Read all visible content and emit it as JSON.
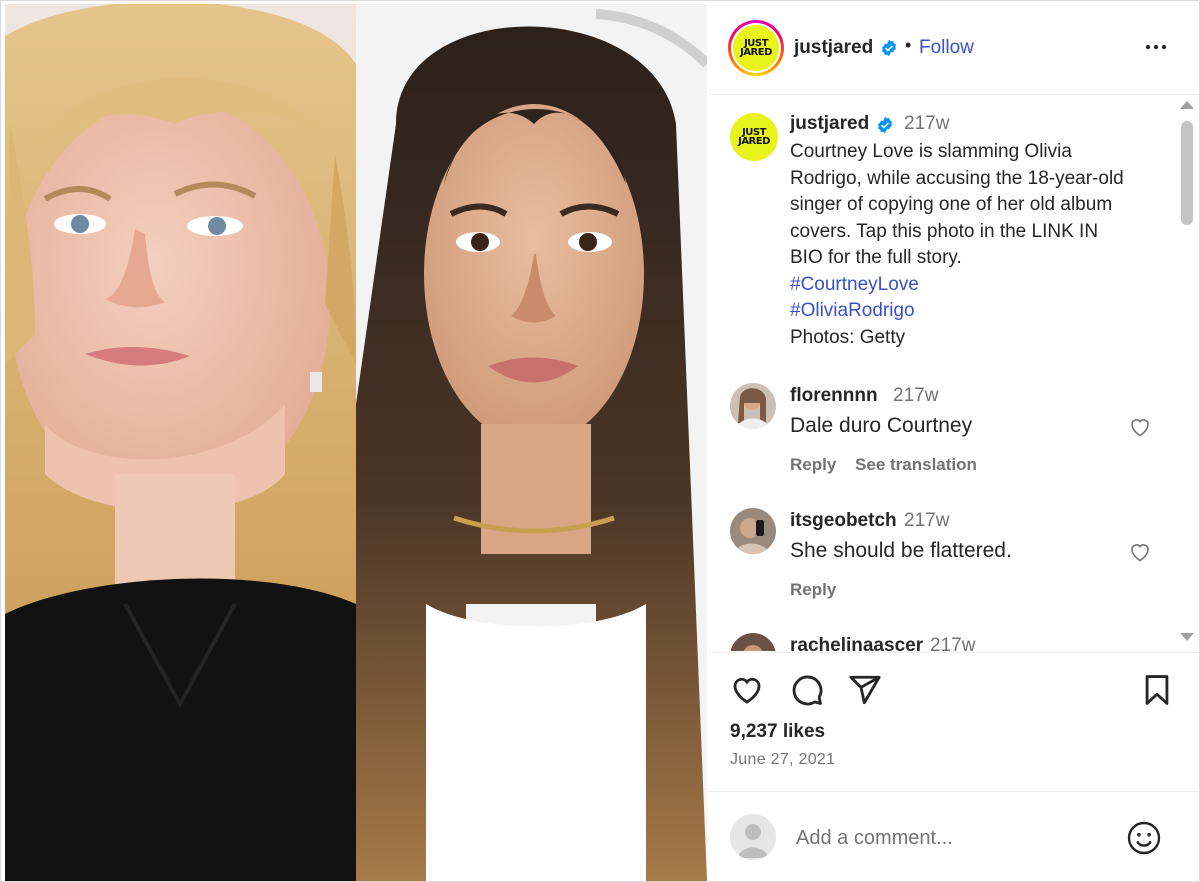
{
  "post_author": {
    "username": "justjared",
    "avatar_text_line1": "JUST",
    "avatar_text_line2": "JARED",
    "separator": "•",
    "follow_label": "Follow"
  },
  "caption": {
    "username": "justjared",
    "time": "217w",
    "lines": [
      "Courtney Love is slamming Olivia",
      "Rodrigo, while accusing the 18-year-old",
      "singer of copying one of her old album",
      "covers. Tap this photo in the LINK IN",
      "BIO for the full story."
    ],
    "hashtags": [
      "#CourtneyLove",
      "#OliviaRodrigo"
    ],
    "credit": "Photos: Getty"
  },
  "comments": [
    {
      "username": "florennnn",
      "time": "217w",
      "text": "Dale duro Courtney",
      "reply_label": "Reply",
      "translate_label": "See translation"
    },
    {
      "username": "itsgeobetch",
      "time": "217w",
      "text": "She should be flattered.",
      "reply_label": "Reply"
    },
    {
      "username": "rachelinaascer",
      "time": "217w"
    }
  ],
  "engagement": {
    "likes": "9,237 likes",
    "date": "June 27, 2021"
  },
  "comment_box": {
    "placeholder": "Add a comment..."
  },
  "colors": {
    "link": "#3a50c8",
    "verified": "#0095f6",
    "logo_yellow": "#e8f31b",
    "muted": "#737373"
  },
  "icons": [
    "more-options-icon",
    "verified-icon",
    "heart-icon",
    "comment-icon",
    "share-icon",
    "bookmark-icon",
    "emoji-icon"
  ]
}
